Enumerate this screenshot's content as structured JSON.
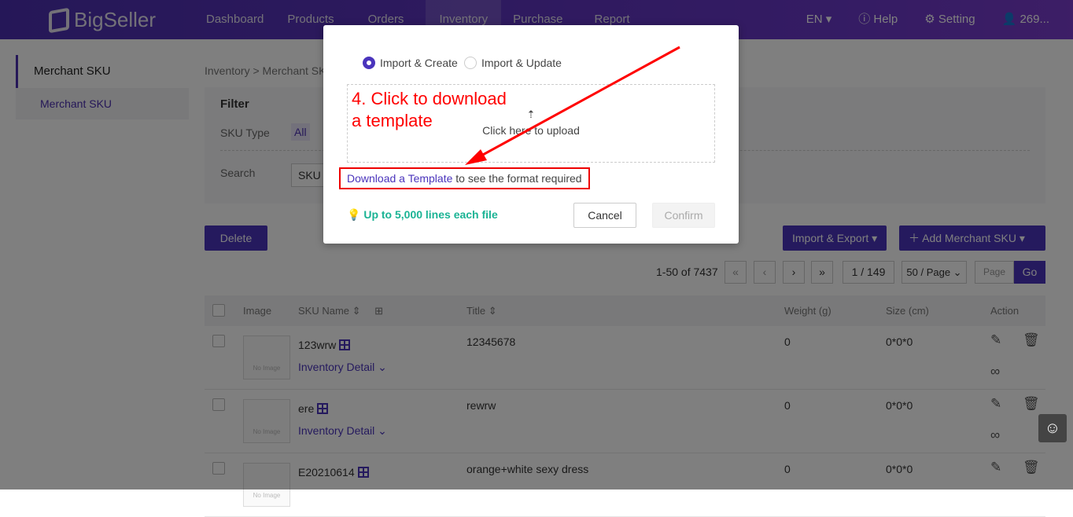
{
  "header": {
    "logo": "BigSeller",
    "nav": [
      "Dashboard",
      "Products",
      "Orders",
      "Inventory",
      "Purchase",
      "Report"
    ],
    "language": "EN",
    "help": "Help",
    "setting": "Setting",
    "user": "269..."
  },
  "sidebar": {
    "title": "Merchant SKU",
    "items": [
      "Merchant SKU"
    ]
  },
  "breadcrumb": "Inventory > Merchant SKU",
  "filter": {
    "title": "Filter",
    "sku_type_label": "SKU Type",
    "sku_type_value": "All",
    "search_label": "Search",
    "search_select": "SKU"
  },
  "toolbar": {
    "delete": "Delete",
    "import_export": "Import & Export",
    "add_sku": "Add Merchant SKU"
  },
  "pagination": {
    "range": "1-50 of 7437",
    "current": "1 / 149",
    "per_page": "50 / Page",
    "page_placeholder": "Page",
    "go": "Go"
  },
  "table": {
    "headers": [
      "Image",
      "SKU Name",
      "Title",
      "Weight (g)",
      "Size (cm)",
      "Action"
    ],
    "rows": [
      {
        "sku": "123wrw",
        "title": "12345678",
        "weight": "0",
        "size": "0*0*0",
        "detail": "Inventory Detail"
      },
      {
        "sku": "ere",
        "title": "rewrw",
        "weight": "0",
        "size": "0*0*0",
        "detail": "Inventory Detail"
      },
      {
        "sku": "E20210614",
        "title": "orange+white sexy dress",
        "weight": "0",
        "size": "0*0*0"
      }
    ],
    "no_image": "No Image"
  },
  "modal": {
    "option_create": "Import & Create",
    "option_update": "Import & Update",
    "selected": "Import & Create",
    "upload_text": "Click here to upload",
    "download_link": "Download a Template",
    "download_suffix": " to see the format required",
    "tip": "Up to 5,000 lines each file",
    "cancel": "Cancel",
    "confirm": "Confirm"
  },
  "annotation": {
    "line1": "4. Click to download",
    "line2": "a template"
  },
  "colors": {
    "brand": "#4a34bc",
    "annotation": "#ff0000",
    "tip": "#1ab394"
  }
}
